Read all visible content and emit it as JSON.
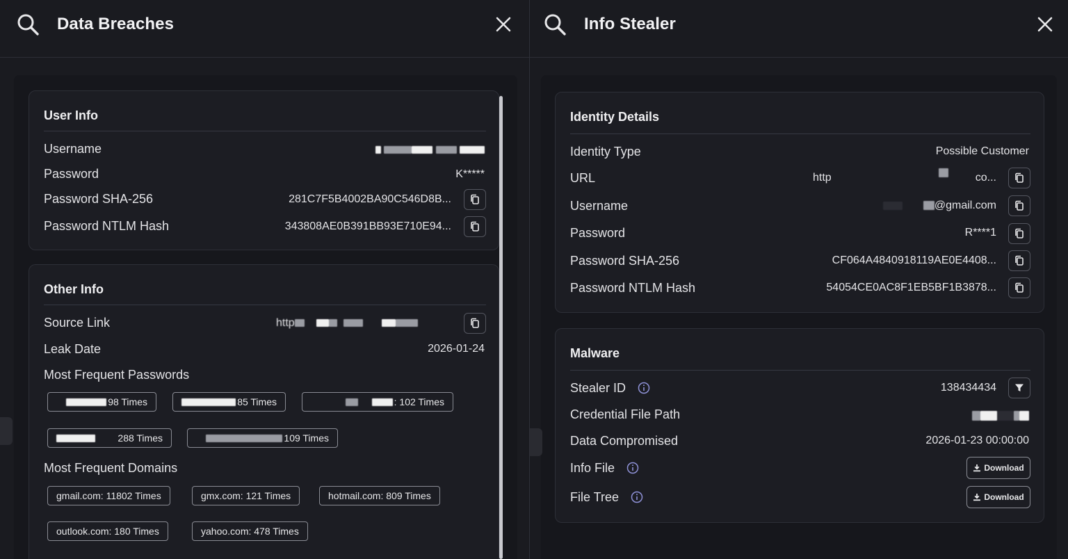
{
  "left_panel": {
    "title": "Data Breaches",
    "user_info": {
      "title": "User Info",
      "rows": [
        {
          "label": "Username",
          "value": ""
        },
        {
          "label": "Password",
          "value": "K*****"
        },
        {
          "label": "Password SHA-256",
          "value": "281C7F5B4002BA90C546D8B..."
        },
        {
          "label": "Password NTLM Hash",
          "value": "343808AE0B391BB93E710E94..."
        }
      ]
    },
    "other_info": {
      "title": "Other Info",
      "source_link_label": "Source Link",
      "source_link_prefix": "http",
      "leak_date_label": "Leak Date",
      "leak_date": "2026-01-24",
      "passwords_label": "Most Frequent Passwords",
      "passwords": [
        "98 Times",
        "85 Times",
        ": 102 Times",
        "288 Times",
        "109 Times"
      ],
      "domains_label": "Most Frequent Domains",
      "domains": [
        "gmail.com: 11802 Times",
        "gmx.com: 121 Times",
        "hotmail.com: 809 Times",
        "outlook.com: 180 Times",
        "yahoo.com: 478 Times"
      ]
    }
  },
  "right_panel": {
    "title": "Info Stealer",
    "identity": {
      "title": "Identity Details",
      "identity_type_label": "Identity Type",
      "identity_type": "Possible Customer",
      "url_label": "URL",
      "url_prefix": "http",
      "url_suffix": "co...",
      "username_label": "Username",
      "username_suffix": "@gmail.com",
      "password_label": "Password",
      "password": "R****1",
      "sha_label": "Password SHA-256",
      "sha": "CF064A4840918119AE0E4408...",
      "ntlm_label": "Password NTLM Hash",
      "ntlm": "54054CE0AC8F1EB5BF1B3878..."
    },
    "malware": {
      "title": "Malware",
      "stealer_id_label": "Stealer ID",
      "stealer_id": "138434434",
      "cred_path_label": "Credential File Path",
      "data_compromised_label": "Data Compromised",
      "data_compromised": "2026-01-23 00:00:00",
      "info_file_label": "Info File",
      "file_tree_label": "File Tree",
      "download_label": "Download"
    }
  },
  "colors": {
    "background": "#17181d",
    "card": "#1c1d23",
    "border": "#2d2f37",
    "text": "#e4e4e7"
  },
  "icons": [
    "search-icon",
    "close-icon",
    "copy-icon",
    "filter-icon",
    "info-icon",
    "download-icon"
  ]
}
